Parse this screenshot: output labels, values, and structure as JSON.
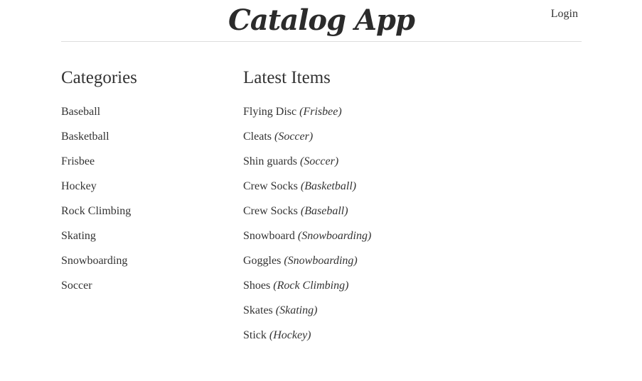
{
  "header": {
    "brand": "Catalog App",
    "login_label": "Login"
  },
  "categories": {
    "heading": "Categories",
    "items": [
      "Baseball",
      "Basketball",
      "Frisbee",
      "Hockey",
      "Rock Climbing",
      "Skating",
      "Snowboarding",
      "Soccer"
    ]
  },
  "latest": {
    "heading": "Latest Items",
    "items": [
      {
        "name": "Flying Disc",
        "category": "(Frisbee)"
      },
      {
        "name": "Cleats",
        "category": "(Soccer)"
      },
      {
        "name": "Shin guards",
        "category": "(Soccer)"
      },
      {
        "name": "Crew Socks",
        "category": "(Basketball)"
      },
      {
        "name": "Crew Socks",
        "category": "(Baseball)"
      },
      {
        "name": "Snowboard",
        "category": "(Snowboarding)"
      },
      {
        "name": "Goggles",
        "category": "(Snowboarding)"
      },
      {
        "name": "Shoes",
        "category": "(Rock Climbing)"
      },
      {
        "name": "Skates",
        "category": "(Skating)"
      },
      {
        "name": "Stick",
        "category": "(Hockey)"
      }
    ]
  }
}
